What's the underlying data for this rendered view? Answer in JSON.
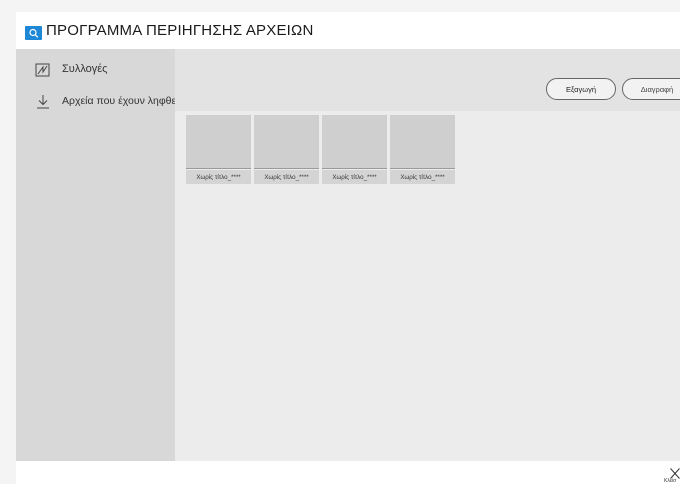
{
  "window": {
    "title": "ΠΡΟΓΡΑΜΜΑ ΠΕΡΙΗΓΗΣΗΣ ΑΡΧΕΙΩΝ",
    "app_icon": "folder-search-icon",
    "accent_color": "#1e88d6"
  },
  "sidebar": {
    "items": [
      {
        "label": "Συλλογές",
        "icon": "collections-icon"
      },
      {
        "label": "Αρχεία που έχουν ληφθεί",
        "icon": "download-icon"
      }
    ]
  },
  "toolbar": {
    "export_label": "Εξαγωγή",
    "delete_label": "Διαγραφή"
  },
  "files": [
    {
      "caption": "Χωρίς τίτλο_****"
    },
    {
      "caption": "Χωρίς τίτλο_****"
    },
    {
      "caption": "Χωρίς τίτλο_****"
    },
    {
      "caption": "Χωρίς τίτλο_****"
    }
  ],
  "footer": {
    "close_label": "Κλείσ",
    "close_icon": "close-icon"
  }
}
